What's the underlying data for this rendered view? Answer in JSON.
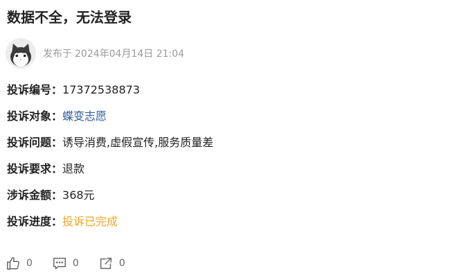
{
  "title": "数据不全，无法登录",
  "author": {
    "avatar_icon": "cat-avatar-icon",
    "publish_prefix": "发布于",
    "publish_time": "2024年04月14日 21:04"
  },
  "fields": [
    {
      "label": "投诉编号：",
      "value": "17372538873",
      "style": "normal"
    },
    {
      "label": "投诉对象：",
      "value": "蝶变志愿",
      "style": "link"
    },
    {
      "label": "投诉问题：",
      "value": "诱导消费,虚假宣传,服务质量差",
      "style": "normal"
    },
    {
      "label": "投诉要求：",
      "value": "退款",
      "style": "normal"
    },
    {
      "label": "涉诉金额：",
      "value": "368元",
      "style": "normal"
    },
    {
      "label": "投诉进度：",
      "value": "投诉已完成",
      "style": "done"
    }
  ],
  "actions": {
    "like": {
      "icon": "thumbs-up-icon",
      "count": "0"
    },
    "comment": {
      "icon": "comment-icon",
      "count": "0"
    },
    "share": {
      "icon": "share-icon",
      "count": "0"
    }
  },
  "colors": {
    "link": "#2f5d9b",
    "status_done": "#f5a623",
    "meta_text": "#9a9a9a"
  }
}
